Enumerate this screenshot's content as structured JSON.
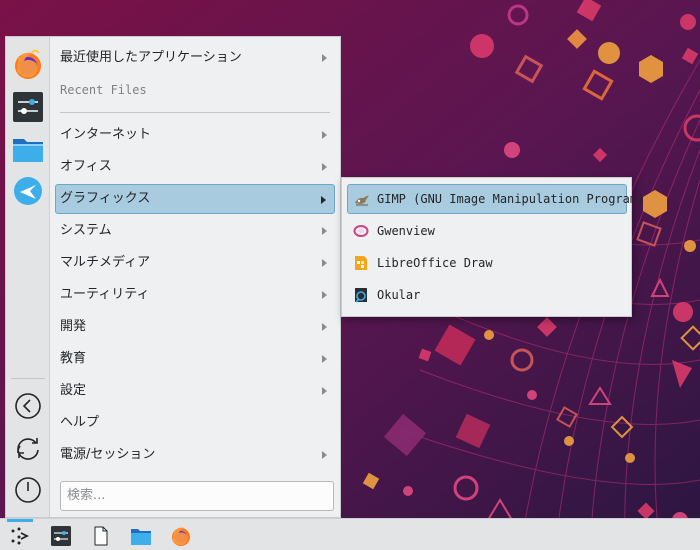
{
  "menu": {
    "recent_apps": "最近使用したアプリケーション",
    "recent_files": "Recent Files",
    "internet": "インターネット",
    "office": "オフィス",
    "graphics": "グラフィックス",
    "system": "システム",
    "multimedia": "マルチメディア",
    "utilities": "ユーティリティ",
    "development": "開発",
    "education": "教育",
    "settings": "設定",
    "help": "ヘルプ",
    "power_session": "電源/セッション"
  },
  "search": {
    "placeholder": "検索..."
  },
  "graphics_submenu": [
    {
      "label": "GIMP (GNU Image Manipulation Program)",
      "icon": "gimp-icon"
    },
    {
      "label": "Gwenview",
      "icon": "gwenview-icon"
    },
    {
      "label": "LibreOffice Draw",
      "icon": "libreoffice-draw-icon"
    },
    {
      "label": "Okular",
      "icon": "okular-icon"
    }
  ],
  "favorites": [
    "firefox-icon",
    "system-settings-icon",
    "dolphin-icon",
    "discover-icon"
  ],
  "power": [
    "lock-icon",
    "logout-icon",
    "shutdown-icon"
  ],
  "taskbar": [
    "application-launcher-icon",
    "system-settings-icon",
    "document-icon",
    "dolphin-icon",
    "firefox-icon"
  ],
  "colors": {
    "highlight": "#a8cbe0",
    "highlight_border": "#6ea5c8",
    "accent": "#3daee9"
  }
}
